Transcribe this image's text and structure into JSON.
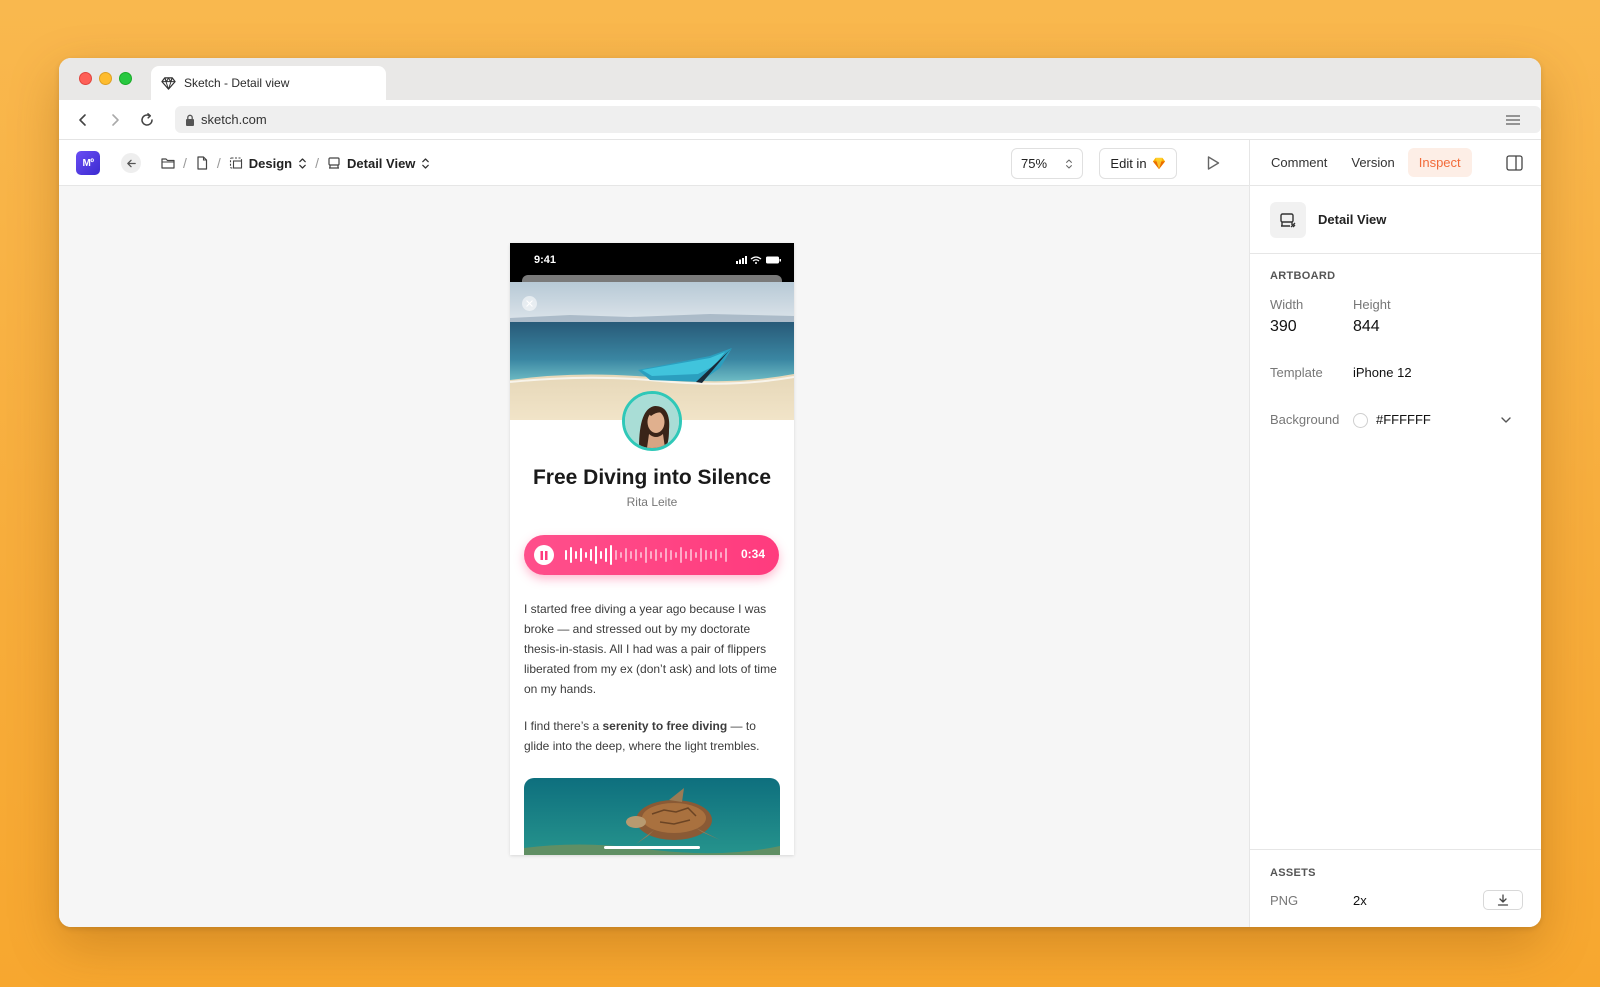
{
  "browser": {
    "tab_title": "Sketch - Detail view",
    "url": "sketch.com"
  },
  "toolbar": {
    "logo_text": "Mº",
    "crumb_page": "Design",
    "crumb_artboard": "Detail View",
    "zoom": "75%",
    "edit_label": "Edit in"
  },
  "inspector": {
    "tabs": [
      "Comment",
      "Version",
      "Inspect"
    ],
    "active_tab": "Inspect",
    "artboard_name": "Detail View",
    "artboard_section": "ARTBOARD",
    "width_label": "Width",
    "width_value": "390",
    "height_label": "Height",
    "height_value": "844",
    "template_label": "Template",
    "template_value": "iPhone 12",
    "background_label": "Background",
    "background_value": "#FFFFFF",
    "assets_section": "ASSETS",
    "asset_format": "PNG",
    "asset_scale": "2x"
  },
  "artboard": {
    "status_time": "9:41",
    "title": "Free Diving into Silence",
    "author": "Rita Leite",
    "player_time": "0:34",
    "paragraph1": "I started free diving a year ago because I was broke — and stressed out by my doctorate thesis-in-stasis. All I had was a pair of flippers liberated from my ex (don’t ask) and lots of time on my hands.",
    "paragraph2_prefix": "I find there’s a ",
    "paragraph2_bold": "serenity to free diving",
    "paragraph2_suffix": " — to glide into the deep, where the light trembles."
  },
  "colors": {
    "accent_inspect": "#F26B3A",
    "player_pink": "#FF3B7E",
    "logo_purple": "#5B3EEB",
    "avatar_ring": "#2FC8B8"
  },
  "icons": [
    "back-icon",
    "forward-icon",
    "reload-icon",
    "lock-icon",
    "menu-icon",
    "folder-icon",
    "document-icon",
    "page-icon",
    "artboard-icon",
    "chevron-updown-icon",
    "play-icon",
    "sketch-diamond-icon",
    "panel-toggle-icon",
    "download-icon",
    "close-icon",
    "pause-icon"
  ]
}
